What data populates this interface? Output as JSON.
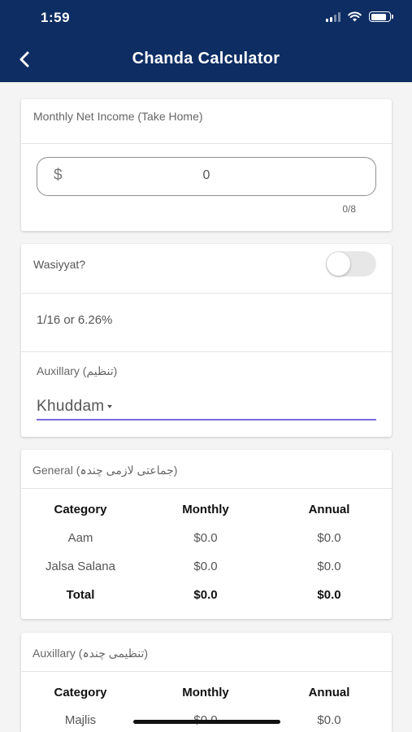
{
  "status_bar": {
    "time": "1:59"
  },
  "header": {
    "title": "Chanda Calculator"
  },
  "income": {
    "label": "Monthly Net Income (Take Home)",
    "currency_symbol": "$",
    "value": "0",
    "counter": "0/8"
  },
  "wasiyyat": {
    "label": "Wasiyyat?",
    "enabled": false,
    "rate": "1/16 or 6.26%",
    "auxiliary_label": "Auxillary (تنظیم)",
    "auxiliary_selected": "Khuddam"
  },
  "general": {
    "title": "General  (جماعتی لازمی چندہ)",
    "columns": [
      "Category",
      "Monthly",
      "Annual"
    ],
    "rows": [
      {
        "category": "Aam",
        "monthly": "$0.0",
        "annual": "$0.0"
      },
      {
        "category": "Jalsa Salana",
        "monthly": "$0.0",
        "annual": "$0.0"
      }
    ],
    "total": {
      "category": "Total",
      "monthly": "$0.0",
      "annual": "$0.0"
    }
  },
  "auxiliary": {
    "title": "Auxillary (تنظیمی چندہ)",
    "columns": [
      "Category",
      "Monthly",
      "Annual"
    ],
    "rows": [
      {
        "category": "Majlis",
        "monthly": "$0.0",
        "annual": "$0.0"
      }
    ]
  },
  "colors": {
    "header_bg": "#0d2d63",
    "accent_underline": "#7b6be0",
    "page_bg": "#f4f4f4"
  }
}
